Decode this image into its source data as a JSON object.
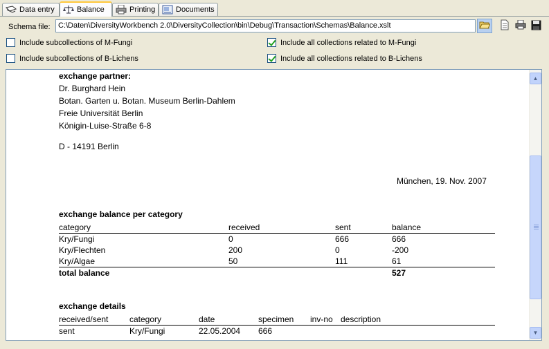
{
  "tabs": [
    {
      "label": "Data entry",
      "icon": "data-entry-icon"
    },
    {
      "label": "Balance",
      "icon": "balance-scale-icon",
      "active": true
    },
    {
      "label": "Printing",
      "icon": "printer-icon"
    },
    {
      "label": "Documents",
      "icon": "documents-icon"
    }
  ],
  "schema": {
    "label": "Schema file:",
    "value": "C:\\Daten\\DiversityWorkbench 2.0\\DiversityCollection\\bin\\Debug\\Transaction\\Schemas\\Balance.xslt"
  },
  "toolbar": [
    "open-folder-icon",
    "document-icon",
    "print-icon",
    "save-icon"
  ],
  "checkboxes": {
    "sub_mfungi": {
      "label": "Include subcollections of M-Fungi",
      "checked": false
    },
    "sub_blichens": {
      "label": "Include subcollections of B-Lichens",
      "checked": false
    },
    "all_mfungi": {
      "label": "Include all collections related to M-Fungi",
      "checked": true
    },
    "all_blichens": {
      "label": "Include all collections related to B-Lichens",
      "checked": true
    }
  },
  "doc": {
    "partner_heading": "exchange partner:",
    "address": [
      "Dr. Burghard Hein",
      "Botan. Garten u. Botan. Museum Berlin-Dahlem",
      "Freie Universität Berlin",
      "Königin-Luise-Straße 6-8"
    ],
    "city": "D - 14191 Berlin",
    "date_line": "München, 19. Nov. 2007",
    "balance_heading": "exchange balance per category",
    "balance_headers": [
      "category",
      "received",
      "sent",
      "balance"
    ],
    "balance_rows": [
      [
        "Kry/Fungi",
        "0",
        "666",
        "666"
      ],
      [
        "Kry/Flechten",
        "200",
        "0",
        "-200"
      ],
      [
        "Kry/Algae",
        "50",
        "111",
        "61"
      ]
    ],
    "total_label": "total balance",
    "total_value": "527",
    "details_heading": "exchange details",
    "details_headers": [
      "received/sent",
      "category",
      "date",
      "specimen",
      "inv-no",
      "description"
    ],
    "details_rows": [
      [
        "sent",
        "Kry/Fungi",
        "22.05.2004",
        "666",
        "",
        ""
      ]
    ]
  }
}
